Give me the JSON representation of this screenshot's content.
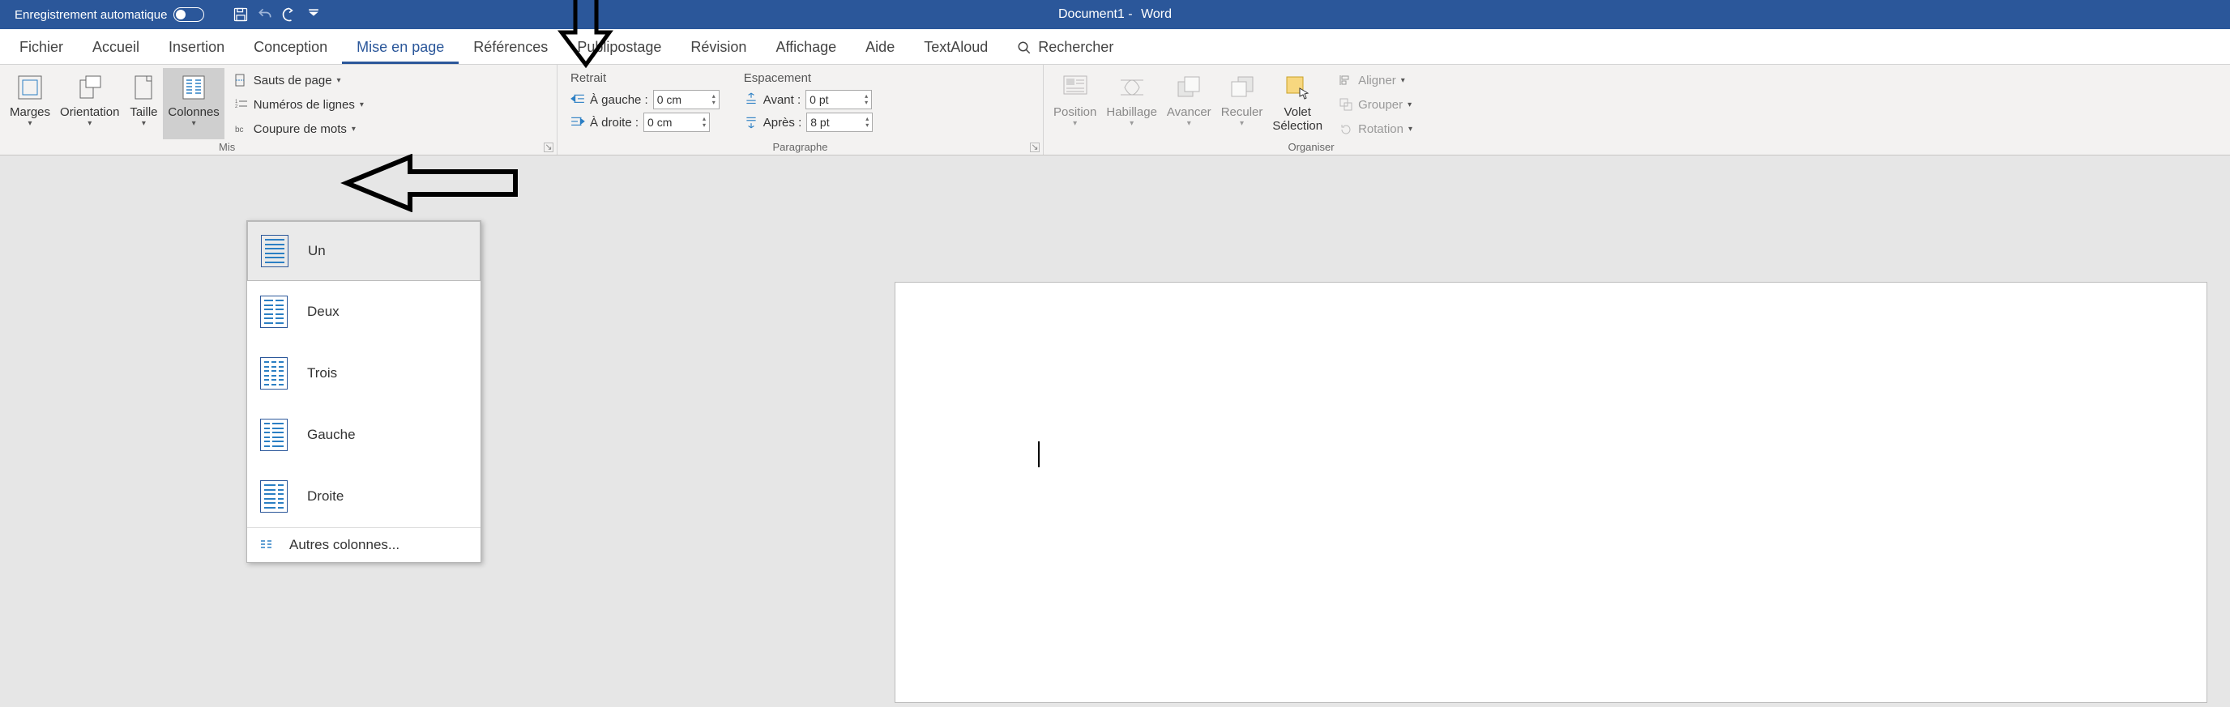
{
  "titlebar": {
    "autosave_label": "Enregistrement automatique",
    "doc_name": "Document1",
    "app_sep": " - ",
    "app_name": "Word"
  },
  "tabs": {
    "fichier": "Fichier",
    "accueil": "Accueil",
    "insertion": "Insertion",
    "conception": "Conception",
    "miseenpage": "Mise en page",
    "references": "Références",
    "publipostage": "Publipostage",
    "revision": "Révision",
    "affichage": "Affichage",
    "aide": "Aide",
    "textaloud": "TextAloud",
    "rechercher": "Rechercher"
  },
  "ribbon": {
    "marges": "Marges",
    "orientation": "Orientation",
    "taille": "Taille",
    "colonnes": "Colonnes",
    "sauts": "Sauts de page",
    "numeros": "Numéros de lignes",
    "coupure": "Coupure de mots",
    "group_mise": "Mis",
    "retrait_title": "Retrait",
    "agauche_label": "À gauche :",
    "agauche_val": "0 cm",
    "adroite_label": "À droite :",
    "adroite_val": "0 cm",
    "espacement_title": "Espacement",
    "avant_label": "Avant :",
    "avant_val": "0 pt",
    "apres_label": "Après :",
    "apres_val": "8 pt",
    "group_para": "Paragraphe",
    "position": "Position",
    "habillage": "Habillage",
    "avancer": "Avancer",
    "reculer": "Reculer",
    "volet": "Volet",
    "selection": "Sélection",
    "aligner": "Aligner",
    "grouper": "Grouper",
    "rotation": "Rotation",
    "group_org": "Organiser"
  },
  "dropdown": {
    "un": "Un",
    "deux": "Deux",
    "trois": "Trois",
    "gauche": "Gauche",
    "droite": "Droite",
    "autres": "Autres colonnes..."
  }
}
